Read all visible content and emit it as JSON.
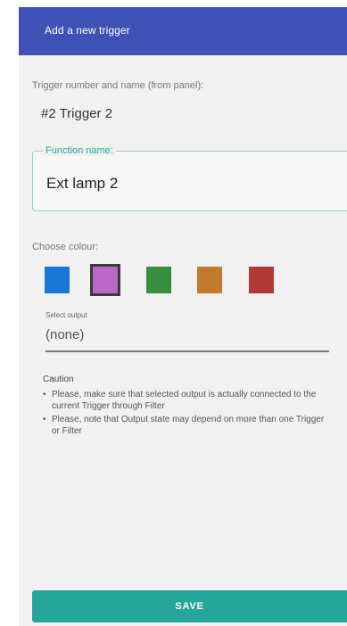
{
  "appbar": {
    "title": "Add a new trigger"
  },
  "trigger": {
    "label": "Trigger number and name (from panel):",
    "value": "#2 Trigger 2"
  },
  "function_name": {
    "label": "Function name:",
    "value": "Ext lamp 2"
  },
  "colour": {
    "label": "Choose colour:",
    "swatches": [
      "#1976d2",
      "#ba68c8",
      "#388e3c",
      "#c17a2e",
      "#b23a36"
    ],
    "selected_index": 1
  },
  "select_output": {
    "label": "Select output",
    "value": "(none)"
  },
  "caution": {
    "title": "Caution",
    "items": [
      "Please, make sure that selected output is actually connected to the current Trigger through Filter",
      "Please, note that Output state may depend on more than one Trigger or Filter"
    ]
  },
  "save_button": {
    "label": "SAVE",
    "color": "#26a69a"
  }
}
